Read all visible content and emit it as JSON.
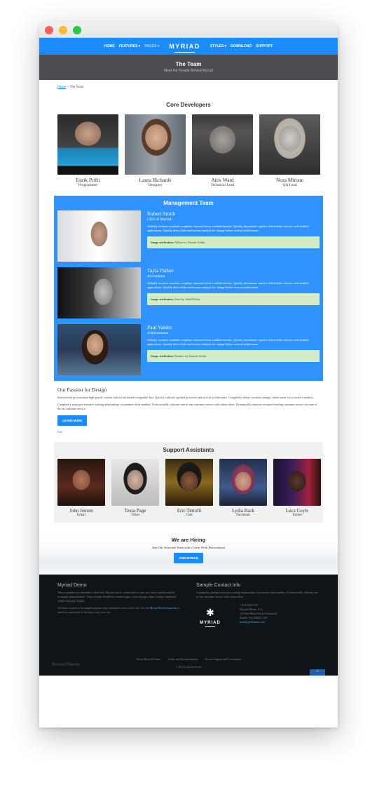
{
  "nav": {
    "items": [
      "HOME",
      "FEATURES ▾",
      "PAGES ▾"
    ],
    "logo": "MYRIAD",
    "items_right": [
      "STYLES ▾",
      "DOWNLOAD",
      "SUPPORT"
    ]
  },
  "hero": {
    "title": "The Team",
    "subtitle": "Meet the People Behind Myriad"
  },
  "breadcrumb": {
    "home": "Home",
    "sep": ">",
    "current": "The Team"
  },
  "core": {
    "title": "Core Developers",
    "people": [
      {
        "name": "Enrik Prifti",
        "role": "Programmer"
      },
      {
        "name": "Laura Richards",
        "role": "Designer"
      },
      {
        "name": "Alex Ward",
        "role": "Technical Lead"
      },
      {
        "name": "Nora Mirone",
        "role": "QA Lead"
      }
    ]
  },
  "management": {
    "title": "Management Team",
    "body": "Globally incubate standards compliant channels before scalable benefits. Quickly disseminate superior deliverables whereas web-enabled applications. Quickly drive clicks-and-mortar catalysts for change before vertical architectures.",
    "attr_label": "Image attribution:",
    "members": [
      {
        "name": "Robert Smith",
        "role": "CEO of Myriad",
        "attribution": "AMaze by Daniele Zedda."
      },
      {
        "name": "Tayla Parker",
        "role": "Accountant",
        "attribution": "Stare by JohnONolan."
      },
      {
        "name": "Paul Valdez",
        "role": "Administrator",
        "attribution": "Bamboo by Daniele Zedda."
      }
    ]
  },
  "passion": {
    "title": "Our Passion for Design",
    "p1": "Interactively procrastinate high-payoff content without backward-compatible data. Quickly cultivate optimal processes and tactical architectures. Completely iterate covalent strategic theme areas via accurate e-markets.",
    "p2": "Completely synergize resource sucking relationships via premier niche markets. Professionally cultivate one-to-one customer service with robust ideas. Dynamically innovate resource-leveling customer service for state of the art customer service.",
    "button": "LEARN MORE",
    "edit": "Edit"
  },
  "support": {
    "title": "Support Assistants",
    "people": [
      {
        "name": "John Jensen",
        "role": "Email"
      },
      {
        "name": "Tessa Page",
        "role": "Ticket"
      },
      {
        "name": "Eric Timofti",
        "role": "Chat"
      },
      {
        "name": "Lydia Back",
        "role": "Facebook"
      },
      {
        "name": "Luca Coyle",
        "role": "Twitter"
      }
    ]
  },
  "hiring": {
    "title": "We are Hiring",
    "subtitle": "Join Our Awesome Team with a Great Work Environment",
    "button": "JOIN MYRIAD"
  },
  "footer": {
    "demo_title": "Myriad Demo",
    "demo_p1": "These examples are intended to show how Myriad can be constructed on your site, above and beyond the frontpage demonstration. These include WordPress content pages, with varying widget content, mainbody widths and page lengths.",
    "demo_p2": "All demo content is for sample purpose only, intended to show a live site. Use the",
    "demo_link": "Myriad RocketLauncher",
    "demo_p2_end": "to install an equivalent of the demo onto your site.",
    "contact_title": "Sample Contact Info",
    "contact_p": "Completely synergize resource sucking relationships via premier niche markets. Professionally cultivate one-to-one customer service with robust ideas.",
    "logo": "MYRIAD",
    "phone": "+1(555)555-555",
    "company": "Myriad Theme, LLC",
    "street": "123 WordPress Rocks Boulevard",
    "city": "Seattle, WA 00000, USA",
    "email": "noreply@domain.com",
    "links": [
      "About Myriad Theme",
      "Guide and Documentation",
      "Forum Support and Community"
    ],
    "copyright": "© 2015 by RocketTheme",
    "brand": "RocketTheme",
    "totop": "^"
  },
  "colors": {
    "accent": "#1a8cff",
    "hero": "#4e4c52",
    "footer": "#0f1419",
    "attr_bg": "#d3ecc8"
  },
  "icons": {
    "totop": "chevron-up-icon",
    "logo": "asterisk-icon"
  }
}
